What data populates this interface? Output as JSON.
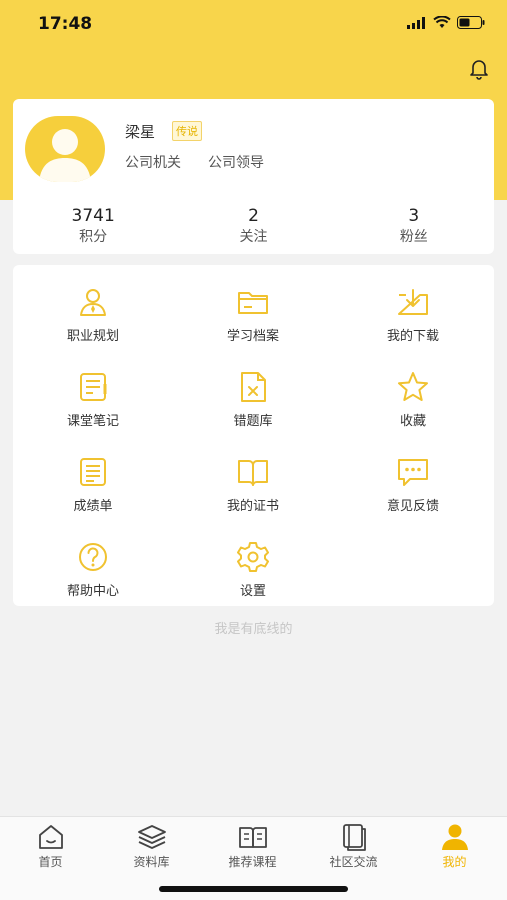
{
  "status_bar": {
    "time": "17:48"
  },
  "profile": {
    "name": "梁星",
    "tag": "传说",
    "org": "公司机关",
    "role": "公司领导"
  },
  "stats": [
    {
      "value": "3741",
      "label": "积分"
    },
    {
      "value": "2",
      "label": "关注"
    },
    {
      "value": "3",
      "label": "粉丝"
    }
  ],
  "menu": [
    {
      "label": "职业规划",
      "icon": "career-icon"
    },
    {
      "label": "学习档案",
      "icon": "folder-icon"
    },
    {
      "label": "我的下载",
      "icon": "download-icon"
    },
    {
      "label": "课堂笔记",
      "icon": "notes-icon"
    },
    {
      "label": "错题库",
      "icon": "wrong-questions-icon"
    },
    {
      "label": "收藏",
      "icon": "star-icon"
    },
    {
      "label": "成绩单",
      "icon": "transcript-icon"
    },
    {
      "label": "我的证书",
      "icon": "book-icon"
    },
    {
      "label": "意见反馈",
      "icon": "feedback-icon"
    },
    {
      "label": "帮助中心",
      "icon": "help-icon"
    },
    {
      "label": "设置",
      "icon": "gear-icon"
    }
  ],
  "footer_note": "我是有底线的",
  "tabs": [
    {
      "label": "首页",
      "icon": "home-icon",
      "active": false
    },
    {
      "label": "资料库",
      "icon": "layers-icon",
      "active": false
    },
    {
      "label": "推荐课程",
      "icon": "open-book-icon",
      "active": false
    },
    {
      "label": "社区交流",
      "icon": "community-book-icon",
      "active": false
    },
    {
      "label": "我的",
      "icon": "user-icon",
      "active": true
    }
  ],
  "colors": {
    "accent": "#f8d54b",
    "icon": "#f0c230",
    "active_tab": "#f0b400"
  }
}
